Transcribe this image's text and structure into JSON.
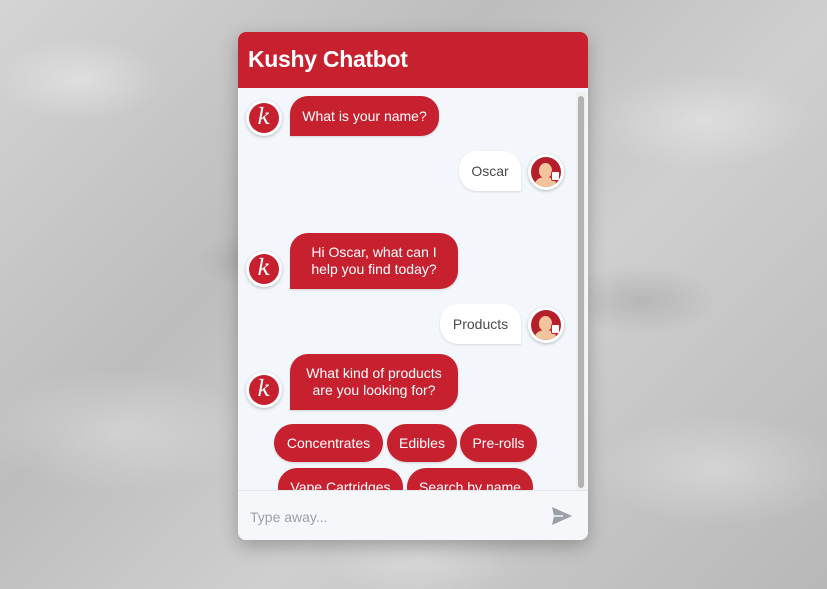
{
  "chatbot": {
    "title": "Kushy Chatbot",
    "bot_avatar_letter": "k",
    "messages": [
      {
        "from": "bot",
        "text": "What is your name?"
      },
      {
        "from": "user",
        "text": "Oscar"
      },
      {
        "from": "bot",
        "line1": "Hi Oscar, what can I",
        "line2": "help you find today?"
      },
      {
        "from": "user",
        "text": "Products"
      },
      {
        "from": "bot",
        "line1": "What kind of products",
        "line2": "are you looking for?"
      }
    ],
    "options": [
      "Concentrates",
      "Edibles",
      "Pre-rolls",
      "Vape Cartridges",
      "Search by name"
    ],
    "input": {
      "placeholder": "Type away...",
      "value": ""
    },
    "icons": {
      "send": "send-icon",
      "bot_avatar": "bot-avatar-icon",
      "user_avatar": "user-avatar-icon"
    },
    "colors": {
      "accent": "#c72130",
      "background": "#f3f6fa"
    }
  }
}
